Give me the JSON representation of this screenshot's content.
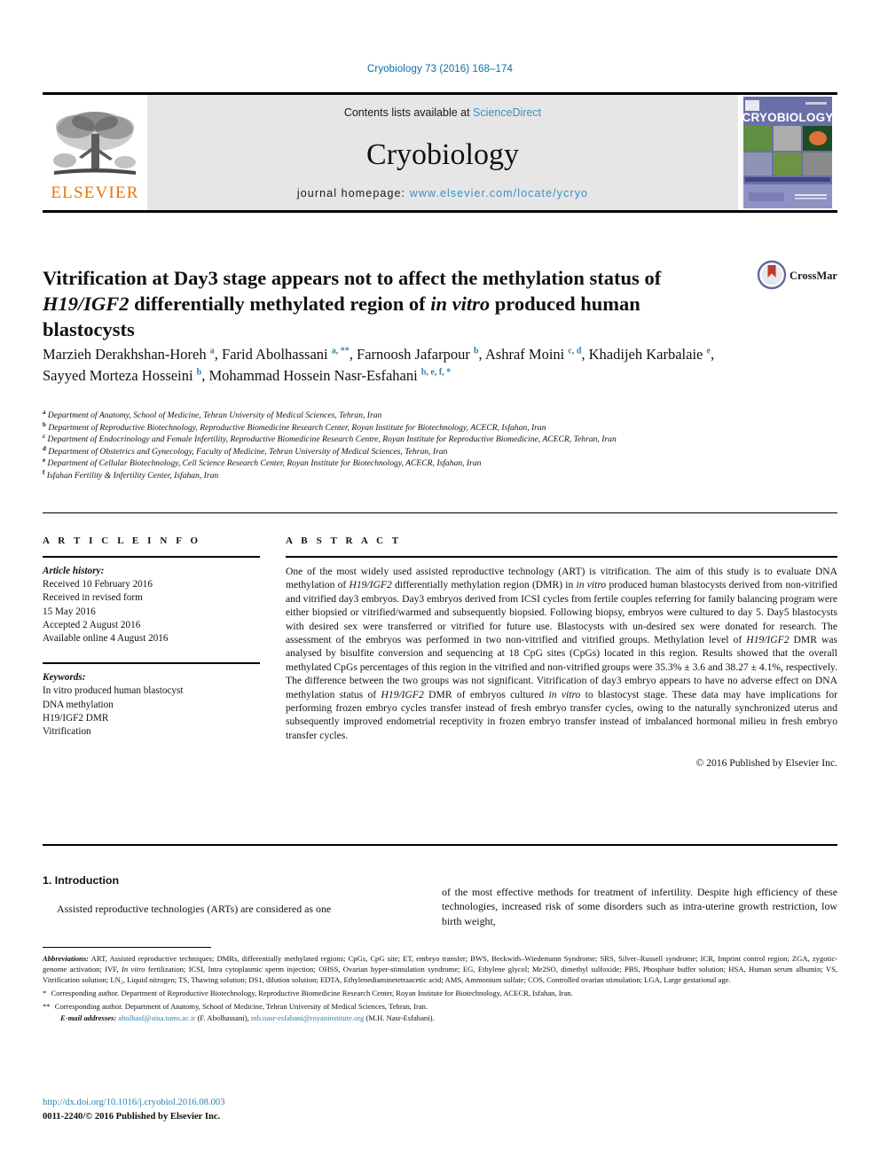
{
  "journal_ref": "Cryobiology 73 (2016) 168–174",
  "masthead": {
    "contents_prefix": "Contents lists available at ",
    "sciencedirect": "ScienceDirect",
    "journal_name": "Cryobiology",
    "homepage_label": "journal homepage: ",
    "homepage_url": "www.elsevier.com/locate/ycryo",
    "publisher_wordmark": "ELSEVIER",
    "cover_title": "CRYOBIOLOGY",
    "accent_orange": "#ec7404",
    "accent_blue": "#3b8fc4",
    "masthead_bg": "#e6e6e6"
  },
  "crossmark": {
    "label": "CrossMark"
  },
  "article": {
    "title_part1": "Vitrification at Day3 stage appears not to affect the methylation status of ",
    "title_italic1": "H19/IGF2",
    "title_part2": " differentially methylated region of ",
    "title_italic2": "in vitro",
    "title_part3": " produced human blastocysts"
  },
  "authors": [
    {
      "name": "Marzieh Derakhshan-Horeh",
      "marks": "a",
      "sep": ", "
    },
    {
      "name": "Farid Abolhassani",
      "marks": "a, **",
      "sep": ", "
    },
    {
      "name": "Farnoosh Jafarpour",
      "marks": "b",
      "sep": ", "
    },
    {
      "name": "Ashraf Moini",
      "marks": "c, d",
      "sep": ", "
    },
    {
      "name": "Khadijeh Karbalaie",
      "marks": "e",
      "sep": ", "
    },
    {
      "name": "Sayyed Morteza Hosseini",
      "marks": "b",
      "sep": ", "
    },
    {
      "name": "Mohammad Hossein Nasr-Esfahani",
      "marks": "b, e, f, *",
      "sep": ""
    }
  ],
  "affiliations": [
    {
      "mark": "a",
      "text": "Department of Anatomy, School of Medicine, Tehran University of Medical Sciences, Tehran, Iran"
    },
    {
      "mark": "b",
      "text": "Department of Reproductive Biotechnology, Reproductive Biomedicine Research Center, Royan Institute for Biotechnology, ACECR, Isfahan, Iran"
    },
    {
      "mark": "c",
      "text": "Department of Endocrinology and Female Infertility, Reproductive Biomedicine Research Centre, Royan Institute for Reproductive Biomedicine, ACECR, Tehran, Iran"
    },
    {
      "mark": "d",
      "text": "Department of Obstetrics and Gynecology, Faculty of Medicine, Tehran University of Medical Sciences, Tehran, Iran"
    },
    {
      "mark": "e",
      "text": "Department of Cellular Biotechnology, Cell Science Research Center, Royan Institute for Biotechnology, ACECR, Isfahan, Iran"
    },
    {
      "mark": "f",
      "text": "Isfahan Fertility & Infertility Center, Isfahan, Iran"
    }
  ],
  "article_info": {
    "heading": "A R T I C L E   I N F O",
    "history_label": "Article history:",
    "history": [
      "Received 10 February 2016",
      "Received in revised form",
      "15 May 2016",
      "Accepted 2 August 2016",
      "Available online 4 August 2016"
    ],
    "keywords_label": "Keywords:",
    "keywords": [
      "In vitro produced human blastocyst",
      "DNA methylation",
      "H19/IGF2 DMR",
      "Vitrification"
    ]
  },
  "abstract": {
    "heading": "A B S T R A C T",
    "p1": "One of the most widely used assisted reproductive technology (ART) is vitrification. The aim of this study is to evaluate DNA methylation of ",
    "i1": "H19/IGF2",
    "p2": " differentially methylation region (DMR) in ",
    "i2": "in vitro",
    "p3": " produced human blastocysts derived from non-vitrified and vitrified day3 embryos. Day3 embryos derived from ICSI cycles from fertile couples referring for family balancing program were either biopsied or vitrified/warmed and subsequently biopsied. Following biopsy, embryos were cultured to day 5. Day5 blastocysts with desired sex were transferred or vitrified for future use. Blastocysts with un-desired sex were donated for research. The assessment of the embryos was performed in two non-vitrified and vitrified groups. Methylation level of ",
    "i3": "H19/IGF2",
    "p4": " DMR was analysed by bisulfite conversion and sequencing at 18 CpG sites (CpGs) located in this region. Results showed that the overall methylated CpGs percentages of this region in the vitrified and non-vitrified groups were 35.3% ± 3.6 and 38.27 ± 4.1%, respectively. The difference between the two groups was not significant. Vitrification of day3 embryo appears to have no adverse effect on DNA methylation status of ",
    "i4": "H19/IGF2",
    "p5": " DMR of embryos cultured ",
    "i5": "in vitro",
    "p6": " to blastocyst stage. These data may have implications for performing frozen embryo cycles transfer instead of fresh embryo transfer cycles, owing to the naturally synchronized uterus and subsequently improved endometrial receptivity in frozen embryo transfer instead of imbalanced hormonal milieu in fresh embryo transfer cycles.",
    "copyright": "© 2016 Published by Elsevier Inc."
  },
  "introduction": {
    "heading": "1. Introduction",
    "left_paragraph": "Assisted reproductive technologies (ARTs) are considered as one",
    "right_paragraph": "of the most effective methods for treatment of infertility. Despite high efficiency of these technologies, increased risk of some disorders such as intra-uterine growth restriction, low birth weight,"
  },
  "footnotes": {
    "abbrev_label": "Abbreviations:",
    "abbrev_pre": " ART, Assisted reproductive techniques; DMRs, differentially methylated regions; CpGs, CpG site; ET, embryo transfer; BWS, Beckwith–Wiedemann Syndrome; SRS, Silver–Russell syndrome; ICR, Imprint control region; ZGA, zygotic-genome activation; IVF, ",
    "abbrev_ital": "In vitro",
    "abbrev_post": " fertilization; ICSI, Intra cytoplasmic sperm injection; OHSS, Ovarian hyper-stimulation syndrome; EG, Ethylene glycol; Me2SO, dimethyl sulfoxide; PBS, Phosphate buffer solution; HSA, Human serum albumin; VS, Vitrification solution; LN₂, Liquid nitrogen; TS, Thawing solution; DS1, dilution solution; EDTA, Ethylenediaminetetraacetic acid; AMS, Ammonium sulfate; COS, Controlled ovarian stimulation; LGA, Large gestational age.",
    "corr1_star": "*",
    "corr1": " Corresponding author. Department of Reproductive Biotechnology, Reproductive Biomedicine Research Center, Royan Institute for Biotechnology, ACECR, Isfahan, Iran.",
    "corr2_star": "**",
    "corr2": " Corresponding author. Department of Anatomy, School of Medicine, Tehran University of Medical Sciences, Tehran, Iran.",
    "email_label": "E-mail addresses:",
    "email1": "abolhasf@sina.tums.ac.ir",
    "email1_owner": " (F. Abolhassani), ",
    "email2": "mh.nasr-esfahani@royaninstitute.org",
    "email2_owner": " (M.H. Nasr-Esfahani)."
  },
  "footer": {
    "doi": "http://dx.doi.org/10.1016/j.cryobiol.2016.08.003",
    "issn": "0011-2240/© 2016 Published by Elsevier Inc."
  }
}
